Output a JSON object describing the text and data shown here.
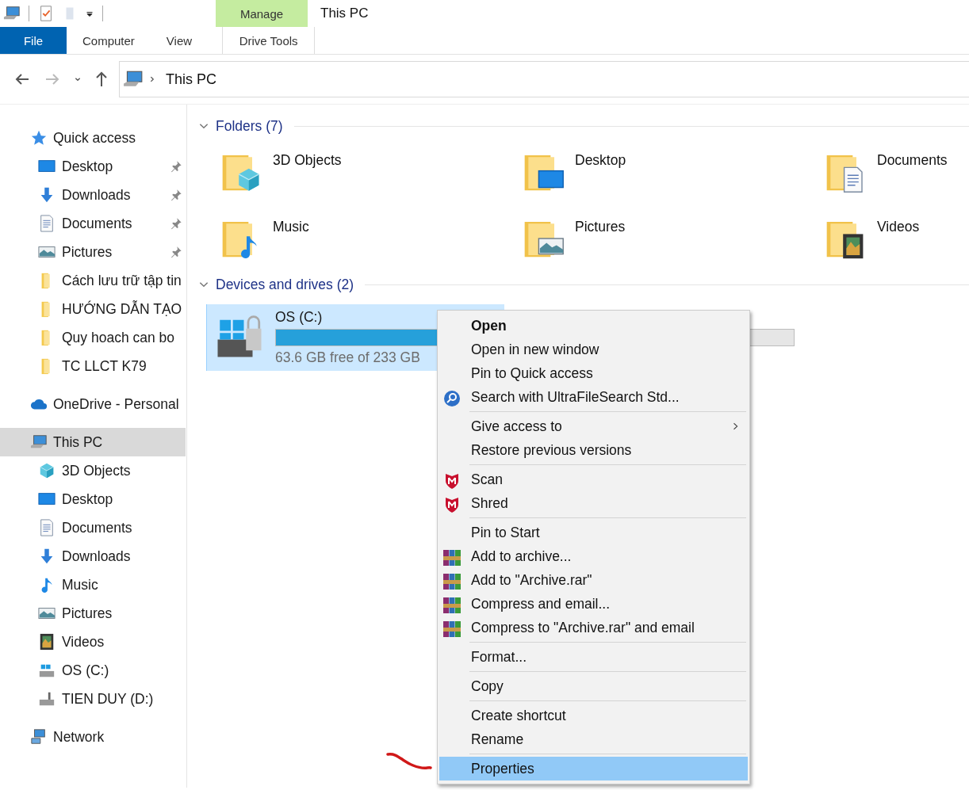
{
  "window": {
    "title": "This PC"
  },
  "ribbon": {
    "context_group": "Manage",
    "tabs": [
      {
        "label": "File",
        "kind": "file",
        "selected": false
      },
      {
        "label": "Computer",
        "kind": "tab",
        "selected": false
      },
      {
        "label": "View",
        "kind": "tab",
        "selected": false
      },
      {
        "label": "Drive Tools",
        "kind": "context",
        "selected": false
      }
    ]
  },
  "address_bar": {
    "path": "This PC"
  },
  "navigation_pane": [
    {
      "label": "Quick access",
      "kind": "star",
      "selected": false,
      "children": [
        {
          "label": "Desktop",
          "kind": "desktop",
          "pinned": true,
          "selected": false
        },
        {
          "label": "Downloads",
          "kind": "downloads",
          "pinned": true,
          "selected": false
        },
        {
          "label": "Documents",
          "kind": "documents",
          "pinned": true,
          "selected": false
        },
        {
          "label": "Pictures",
          "kind": "pictures",
          "pinned": true,
          "selected": false
        },
        {
          "label": "Cách lưu trữ tập tin",
          "kind": "folder",
          "pinned": false,
          "selected": false
        },
        {
          "label": "HƯỚNG DẪN TẠO",
          "kind": "folder",
          "pinned": false,
          "selected": false
        },
        {
          "label": "Quy hoach can bo",
          "kind": "folder",
          "pinned": false,
          "selected": false
        },
        {
          "label": "TC LLCT K79",
          "kind": "folder",
          "pinned": false,
          "selected": false
        }
      ]
    },
    {
      "label": "OneDrive - Personal",
      "kind": "cloud",
      "selected": false
    },
    {
      "label": "This PC",
      "kind": "pc",
      "selected": true,
      "children": [
        {
          "label": "3D Objects",
          "kind": "objects",
          "pinned": false,
          "selected": false
        },
        {
          "label": "Desktop",
          "kind": "desktop",
          "pinned": false,
          "selected": false
        },
        {
          "label": "Documents",
          "kind": "documents",
          "pinned": false,
          "selected": false
        },
        {
          "label": "Downloads",
          "kind": "downloads",
          "pinned": false,
          "selected": false
        },
        {
          "label": "Music",
          "kind": "music",
          "pinned": false,
          "selected": false
        },
        {
          "label": "Pictures",
          "kind": "pictures",
          "pinned": false,
          "selected": false
        },
        {
          "label": "Videos",
          "kind": "videos",
          "pinned": false,
          "selected": false
        },
        {
          "label": "OS (C:)",
          "kind": "drive-os",
          "pinned": false,
          "selected": false
        },
        {
          "label": "TIEN DUY (D:)",
          "kind": "drive",
          "pinned": false,
          "selected": false
        }
      ]
    },
    {
      "label": "Network",
      "kind": "network",
      "selected": false
    }
  ],
  "folders": {
    "heading": "Folders (7)",
    "expanded": true,
    "items": [
      {
        "name": "3D Objects",
        "kind": "objects"
      },
      {
        "name": "Desktop",
        "kind": "desktop"
      },
      {
        "name": "Documents",
        "kind": "documents"
      },
      {
        "name": "Music",
        "kind": "music"
      },
      {
        "name": "Pictures",
        "kind": "pictures"
      },
      {
        "name": "Videos",
        "kind": "videos"
      }
    ]
  },
  "devices": {
    "heading": "Devices and drives (2)",
    "expanded": true,
    "items": [
      {
        "name": "OS (C:)",
        "level": 0.73,
        "free": "63.6 GB free of 233 GB",
        "selected": true
      }
    ]
  },
  "context_menu": [
    [
      {
        "label": "Open",
        "kind": "default",
        "submenu": false,
        "selected": false
      },
      {
        "label": "Open in new window",
        "kind": "plain",
        "submenu": false,
        "selected": false
      },
      {
        "label": "Pin to Quick access",
        "kind": "plain",
        "submenu": false,
        "selected": false
      },
      {
        "label": "Search with UltraFileSearch Std...",
        "kind": "search",
        "submenu": false,
        "selected": false
      }
    ],
    [
      {
        "label": "Give access to",
        "kind": "plain",
        "submenu": true,
        "selected": false
      },
      {
        "label": "Restore previous versions",
        "kind": "plain",
        "submenu": false,
        "selected": false
      }
    ],
    [
      {
        "label": "Scan",
        "kind": "shield",
        "submenu": false,
        "selected": false
      },
      {
        "label": "Shred",
        "kind": "shield",
        "submenu": false,
        "selected": false
      }
    ],
    [
      {
        "label": "Pin to Start",
        "kind": "plain",
        "submenu": false,
        "selected": false
      },
      {
        "label": "Add to archive...",
        "kind": "archive",
        "submenu": false,
        "selected": false
      },
      {
        "label": "Add to \"Archive.rar\"",
        "kind": "archive",
        "submenu": false,
        "selected": false
      },
      {
        "label": "Compress and email...",
        "kind": "archive",
        "submenu": false,
        "selected": false
      },
      {
        "label": "Compress to \"Archive.rar\" and email",
        "kind": "archive",
        "submenu": false,
        "selected": false
      }
    ],
    [
      {
        "label": "Format...",
        "kind": "plain",
        "submenu": false,
        "selected": false
      }
    ],
    [
      {
        "label": "Copy",
        "kind": "plain",
        "submenu": false,
        "selected": false
      }
    ],
    [
      {
        "label": "Create shortcut",
        "kind": "plain",
        "submenu": false,
        "selected": false
      },
      {
        "label": "Rename",
        "kind": "plain",
        "submenu": false,
        "selected": false
      }
    ],
    [
      {
        "label": "Properties",
        "kind": "plain",
        "submenu": false,
        "selected": true
      }
    ]
  ]
}
